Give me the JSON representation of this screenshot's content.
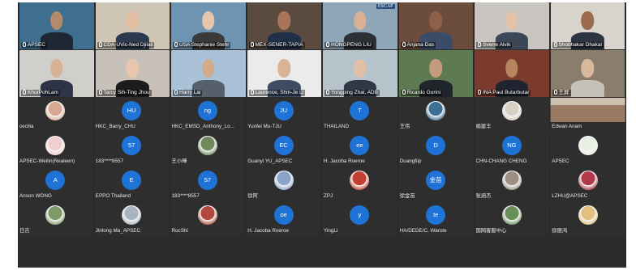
{
  "video_row_1": [
    {
      "name": "APSEC",
      "bg": "#3f6f8e",
      "skin": "#b58a6b",
      "shirt": "#1d2733"
    },
    {
      "name": "CDA-UVic-Ned Djilali",
      "bg": "#cfc6b6",
      "skin": "#e2bfa2",
      "shirt": "#2c3a4f"
    },
    {
      "name": "USA Stephanie Stehr",
      "bg": "#6f94b2",
      "skin": "#e6c6ac",
      "shirt": "#3a3a3a"
    },
    {
      "name": "MEX-SENER-TAPIA",
      "bg": "#5b4a3f",
      "skin": "#a87656",
      "shirt": "#1f2f48"
    },
    {
      "name": "HONGPENG LIU",
      "bg": "#8fa6b8",
      "skin": "#d8b094",
      "shirt": "#2d2f36",
      "badge": "ESCAP"
    },
    {
      "name": "Anjana Das",
      "bg": "#6b4c3d",
      "skin": "#8f6048",
      "shirt": "#3a4c67"
    },
    {
      "name": "Sverre Alvik",
      "bg": "#c9c5c0",
      "skin": "#e3c2aa",
      "shirt": "#3b4656"
    },
    {
      "name": "Shobhakar Dhakal",
      "bg": "#d8d3cb",
      "skin": "#9c6b4d",
      "shirt": "#2c3440"
    }
  ],
  "video_row_2": [
    {
      "name": "KhorPohLam",
      "bg": "#d1cfcc",
      "skin": "#d8b295",
      "shirt": "#2d3446"
    },
    {
      "name": "Tarcy Sih-Ting Jhou",
      "bg": "#c7c1ba",
      "skin": "#e6c7ae",
      "shirt": "#1c1c1c"
    },
    {
      "name": "Harry Lai",
      "bg": "#a9c2d8",
      "skin": "#d1ab8c",
      "shirt": "#56606b"
    },
    {
      "name": "Laurence, Shin-Je Li",
      "bg": "#ebebeb",
      "skin": "#d9b396",
      "shirt": "#3e4c63"
    },
    {
      "name": "Yongping Zhai, ADB",
      "bg": "#b8c4cc",
      "skin": "#e1c0a6",
      "shirt": "#2f3845"
    },
    {
      "name": "Ricardo Gorini",
      "bg": "#5d7a52",
      "skin": "#c49b7c",
      "shirt": "#20252b"
    },
    {
      "name": "INA Paul Butarbutar",
      "bg": "#7a3b2c",
      "skin": "#b68561",
      "shirt": "#1e2430"
    },
    {
      "name": "王屏",
      "bg": "#8a7d6b",
      "skin": "#d9b89c",
      "shirt": "#c7c2b8"
    }
  ],
  "audio_rows": [
    [
      {
        "name": "cecilia",
        "photo": "#d9a892"
      },
      {
        "name": "HKC_Barry_CHU",
        "initials": "HU"
      },
      {
        "name": "HKC_EMSD_Anthony_Lo...",
        "initials": "ng"
      },
      {
        "name": "Yunfei Mu-TJU",
        "initials": "JU"
      },
      {
        "name": "THAILAND",
        "initials": "T"
      },
      {
        "name": "王伟",
        "photo": "#3e6f94"
      },
      {
        "name": "楊建丰",
        "photo": "#d8d0c4"
      },
      {
        "name": "Edwan Anam",
        "photo": "#9a7a62",
        "wide": true
      }
    ],
    [
      {
        "name": "APSEC-Weilin(Realeen)",
        "photo": "#f0d0cf"
      },
      {
        "name": "183****8557",
        "initials": "57"
      },
      {
        "name": "王小暉",
        "photo": "#6e8a5b"
      },
      {
        "name": "Guanyi YU_APSEC",
        "initials": "EC"
      },
      {
        "name": "H. Jacoba Roeroe",
        "initials": "ee"
      },
      {
        "name": "Duangfiip",
        "initials": "D"
      },
      {
        "name": "CHN-CHANG CHENG",
        "initials": "NG"
      },
      {
        "name": "APSEC",
        "photo": "#e7efe0"
      }
    ],
    [
      {
        "name": "Anson WONG",
        "initials": "A"
      },
      {
        "name": "EPPO Thailand",
        "initials": "E"
      },
      {
        "name": "183****8557",
        "initials": "57"
      },
      {
        "name": "徐阿",
        "photo": "#8aa4c8"
      },
      {
        "name": "ZPJ",
        "photo": "#c23e2e"
      },
      {
        "name": "徐金苗",
        "initials": "金苗"
      },
      {
        "name": "张涵杰",
        "photo": "#9b8f82"
      },
      {
        "name": "LZHU@APSEC",
        "photo": "#b2384a"
      }
    ],
    [
      {
        "name": "日吉",
        "photo": "#7e9a6b"
      },
      {
        "name": "Jinlong Ma_APSEC",
        "photo": "#a9b4bf"
      },
      {
        "name": "RocShi",
        "photo": "#b04a3c"
      },
      {
        "name": "H. Jacoba Roeroe",
        "initials": "oe"
      },
      {
        "name": "YingLi",
        "initials": "y"
      },
      {
        "name": "HA/DEDE/C. Warote",
        "initials": "te"
      },
      {
        "name": "国网客服中心",
        "photo": "#6a8e58"
      },
      {
        "name": "徐丽鸿",
        "photo": "#e2c07b"
      }
    ]
  ]
}
